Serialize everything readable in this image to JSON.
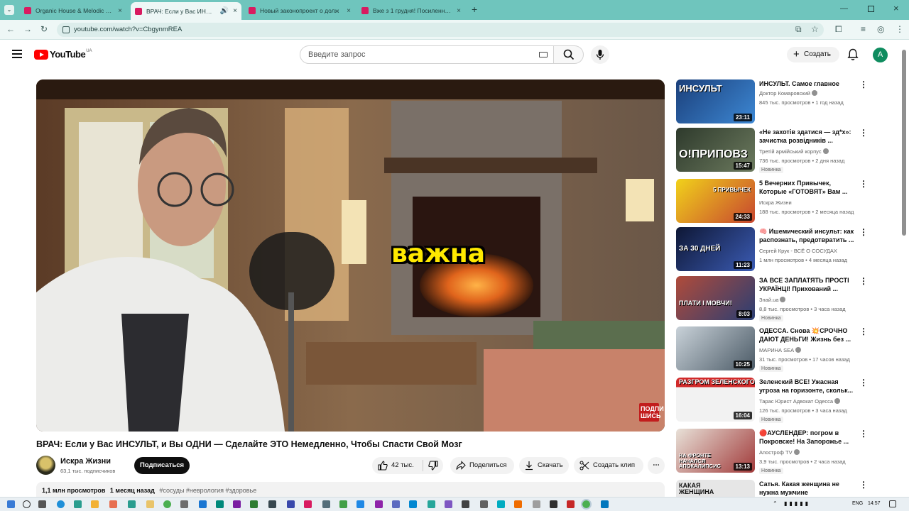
{
  "browser": {
    "tabs": [
      {
        "title": "Organic House & Melodic Hou",
        "active": false
      },
      {
        "title": "ВРАЧ: Если у Вас ИНСУЛЬТ",
        "active": true
      },
      {
        "title": "Новый законопроект о долж",
        "active": false
      },
      {
        "title": "Вже з 1 грудня! Посилення пр",
        "active": false
      }
    ],
    "new_tab": "+",
    "url": "youtube.com/watch?v=CbgynmREA"
  },
  "header": {
    "logo_text": "YouTube",
    "region": "UA",
    "search_placeholder": "Введите запрос",
    "create_label": "Создать",
    "avatar_letter": "A"
  },
  "video": {
    "caption": "важна",
    "watermark": "ПОДПИ ШИСЬ",
    "title": "ВРАЧ: Если у Вас ИНСУЛЬТ, и Вы ОДНИ — Сделайте ЭТО Немедленно, Чтобы Спасти Свой Мозг",
    "channel": "Искра Жизни",
    "subscribers": "63,1 тыс. подписчиков",
    "subscribe_label": "Подписаться",
    "likes": "42 тыс.",
    "share_label": "Поделиться",
    "download_label": "Скачать",
    "clip_label": "Создать клип",
    "views": "1,1 млн просмотров",
    "age": "1 месяц назад",
    "tags": "#сосуды #неврология #здоровье"
  },
  "recommendations": [
    {
      "title": "ИНСУЛЬТ. Самое главное",
      "channel": "Доктор Комаровский",
      "verified": true,
      "meta": "845 тыс. просмотров • 1 год назад",
      "new": "",
      "duration": "23:11",
      "thumb_text": "ИНСУЛЬТ",
      "thumb_color": "#2a6fb5"
    },
    {
      "title": "«Не захотів здатися — зд*х»: зачистка розвідників ...",
      "channel": "Третій армійський корпус",
      "verified": true,
      "meta": "736 тыс. просмотров • 2 дня назад",
      "new": "Новинка",
      "duration": "15:47",
      "thumb_text": "О!ПРИПОВЗ",
      "thumb_color": "#3d4a3a"
    },
    {
      "title": "5 Вечерних Привычек, Которые «ГОТОВЯТ» Вам ...",
      "channel": "Искра Жизни",
      "verified": false,
      "meta": "188 тыс. просмотров • 2 месяца назад",
      "new": "",
      "duration": "24:33",
      "thumb_text": "5 ПРИВЫЧЕК",
      "thumb_color": "#c7462f"
    },
    {
      "title": "🧠 Ишемический инсульт: как распознать, предотвратить ...",
      "channel": "Сергей Крук - ВСЁ О СОСУДАХ",
      "verified": false,
      "meta": "1 млн просмотров • 4 месяца назад",
      "new": "",
      "duration": "11:23",
      "thumb_text": "ЗА 30 ДНЕЙ",
      "thumb_color": "#1f2b52"
    },
    {
      "title": "ЗА ВСЕ ЗАПЛАТЯТЬ ПРОСТІ УКРАЇНЦІ! Прихований ...",
      "channel": "Знай.ua",
      "verified": true,
      "meta": "8,8 тыс. просмотров • 3 часа назад",
      "new": "Новинка",
      "duration": "8:03",
      "thumb_text": "ПЛАТИ І МОВЧИ!",
      "thumb_color": "#7a2f33"
    },
    {
      "title": "ОДЕССА. Снова 💥СРОЧНО ДАЮТ ДЕНЬГИ! Жизнь без ...",
      "channel": "МАРИНА SEA",
      "verified": true,
      "meta": "31 тыс. просмотров • 17 часов назад",
      "new": "Новинка",
      "duration": "10:25",
      "thumb_text": "",
      "thumb_color": "#5f7180"
    },
    {
      "title": "Зеленский ВСЕ! Ужасная угроза на горизонте, скольк...",
      "channel": "Тарас Юрист Адвокат Одесса",
      "verified": true,
      "meta": "126 тыс. просмотров • 3 часа назад",
      "new": "Новинка",
      "duration": "16:04",
      "thumb_text": "РАЗГРОМ ЗЕЛЕНСКОГО",
      "thumb_color": "#2b2b2b"
    },
    {
      "title": "🔴АУСЛЕНДЕР: погром в Покровске! На Запорожье ...",
      "channel": "Апостроф TV",
      "verified": true,
      "meta": "3,9 тыс. просмотров • 2 часа назад",
      "new": "Новинка",
      "duration": "13:13",
      "thumb_text": "НА ФРОНТЕ НАЧАЛСЯ АПОКАЛИПСИС",
      "thumb_color": "#8a3a3a"
    },
    {
      "title": "Сатья. Какая женщина не нужна мужчине",
      "channel": "",
      "verified": false,
      "meta": "",
      "new": "",
      "duration": "",
      "thumb_text": "КАКАЯ ЖЕНЩИНА",
      "thumb_color": "#d8d8d8"
    }
  ],
  "taskbar": {
    "lang": "ENG",
    "time": "14:57"
  }
}
